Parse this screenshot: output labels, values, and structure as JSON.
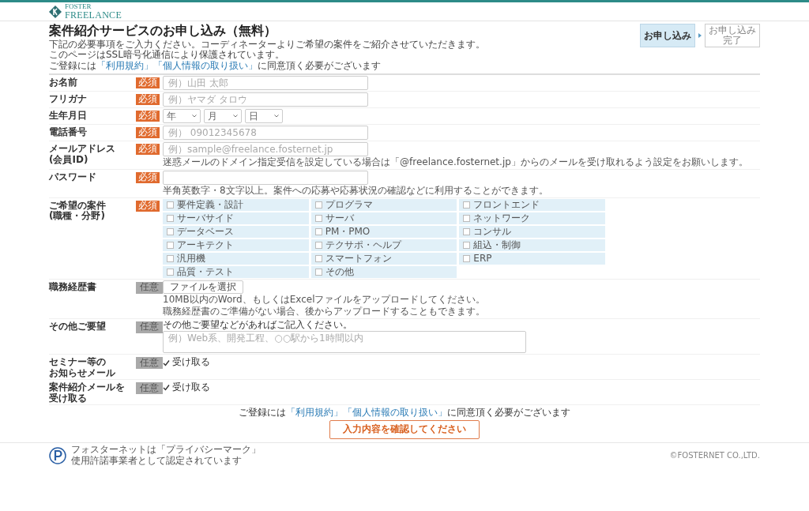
{
  "header": {
    "logo_top": "FOSTER",
    "logo_bottom": "FREELANCE"
  },
  "title": "案件紹介サービスのお申し込み（無料）",
  "steps": [
    {
      "label": "お申し込み",
      "selected": true
    },
    {
      "label": "お申し込み完了",
      "selected": false
    }
  ],
  "intro": [
    "下記の必要事項をご入力ください。コーディネーターよりご希望の案件をご紹介させていただきます。",
    "このページはSSL暗号化通信により保護されています。"
  ],
  "consent": [
    {
      "kind": "text",
      "text": "ご登録には"
    },
    {
      "kind": "link",
      "text": "「利用規約」"
    },
    {
      "kind": "link",
      "text": "「個人情報の取り扱い」"
    },
    {
      "kind": "text",
      "text": "に同意頂く必要がございます"
    }
  ],
  "fields": [
    {
      "kind": "text",
      "label": [
        "お名前"
      ],
      "badge": {
        "kind": "required",
        "text": "必須"
      },
      "placeholder": "例）山田 太郎"
    },
    {
      "kind": "text",
      "label": [
        "フリガナ"
      ],
      "badge": {
        "kind": "required",
        "text": "必須"
      },
      "placeholder": "例）ヤマダ タロウ"
    },
    {
      "kind": "date",
      "label": [
        "生年月日"
      ],
      "badge": {
        "kind": "required",
        "text": "必須"
      },
      "selects": [
        "年",
        "月",
        "日"
      ]
    },
    {
      "kind": "text",
      "label": [
        "電話番号"
      ],
      "badge": {
        "kind": "required",
        "text": "必須"
      },
      "placeholder": "例） 09012345678"
    },
    {
      "kind": "text",
      "label": [
        "メールアドレス",
        "(会員ID)"
      ],
      "badge": {
        "kind": "required",
        "text": "必須"
      },
      "placeholder": "例）sample@freelance.fosternet.jp",
      "note": [
        "迷惑メールのドメイン指定受信を設定している場合は「@freelance.fosternet.jp」からのメールを受け取れるよう設定をお願いします。"
      ]
    },
    {
      "kind": "text",
      "label": [
        "パスワード"
      ],
      "badge": {
        "kind": "required",
        "text": "必須"
      },
      "note": [
        "半角英数字・8文字以上。案件への応募や応募状況の確認などに利用することができます。"
      ]
    },
    {
      "kind": "checkgrid",
      "label": [
        "ご希望の案件",
        "(職種・分野)"
      ],
      "badge": {
        "kind": "required",
        "text": "必須"
      },
      "options": [
        {
          "label": "要件定義・設計",
          "checked": false
        },
        {
          "label": "プログラマ",
          "checked": false
        },
        {
          "label": "フロントエンド",
          "checked": false
        },
        {
          "label": "サーバサイド",
          "checked": false
        },
        {
          "label": "サーバ",
          "checked": false
        },
        {
          "label": "ネットワーク",
          "checked": false
        },
        {
          "label": "データベース",
          "checked": false
        },
        {
          "label": "PM・PMO",
          "checked": false
        },
        {
          "label": "コンサル",
          "checked": false
        },
        {
          "label": "アーキテクト",
          "checked": false
        },
        {
          "label": "テクサポ・ヘルプ",
          "checked": false
        },
        {
          "label": "組込・制御",
          "checked": false
        },
        {
          "label": "汎用機",
          "checked": false
        },
        {
          "label": "スマートフォン",
          "checked": false
        },
        {
          "label": "ERP",
          "checked": false
        },
        {
          "label": "品質・テスト",
          "checked": false
        },
        {
          "label": "その他",
          "checked": false
        }
      ]
    },
    {
      "kind": "file",
      "label": [
        "職務経歴書"
      ],
      "badge": {
        "kind": "optional",
        "text": "任意"
      },
      "button": "ファイルを選択",
      "note": [
        "10MB以内のWord、もしくはExcelファイルをアップロードしてください。",
        "職務経歴書のご準備がない場合、後からアップロードすることもできます。"
      ]
    },
    {
      "kind": "textarea",
      "label": [
        "その他ご要望"
      ],
      "badge": {
        "kind": "optional",
        "text": "任意"
      },
      "prompt": "その他ご要望などがあればご記入ください。",
      "placeholder": "例）Web系、開発工程、○○駅から1時間以内"
    },
    {
      "kind": "checkbox",
      "label": [
        "セミナー等の",
        "お知らせメール"
      ],
      "badge": {
        "kind": "optional",
        "text": "任意"
      },
      "option": "受け取る",
      "checked": true
    },
    {
      "kind": "checkbox",
      "label": [
        "案件紹介メールを",
        "受け取る"
      ],
      "badge": {
        "kind": "optional",
        "text": "任意"
      },
      "option": "受け取る",
      "checked": true
    }
  ],
  "consent_bottom": [
    {
      "kind": "text",
      "text": "ご登録には"
    },
    {
      "kind": "link",
      "text": "「利用規約」"
    },
    {
      "kind": "link",
      "text": "「個人情報の取り扱い」"
    },
    {
      "kind": "text",
      "text": "に同意頂く必要がございます"
    }
  ],
  "submit": "入力内容を確認してください",
  "footer": {
    "privacy": [
      "フォスターネットは「プライバシーマーク」",
      "使用許諾事業者として認定されています"
    ],
    "copyright": "©FOSTERNET CO.,LTD."
  }
}
